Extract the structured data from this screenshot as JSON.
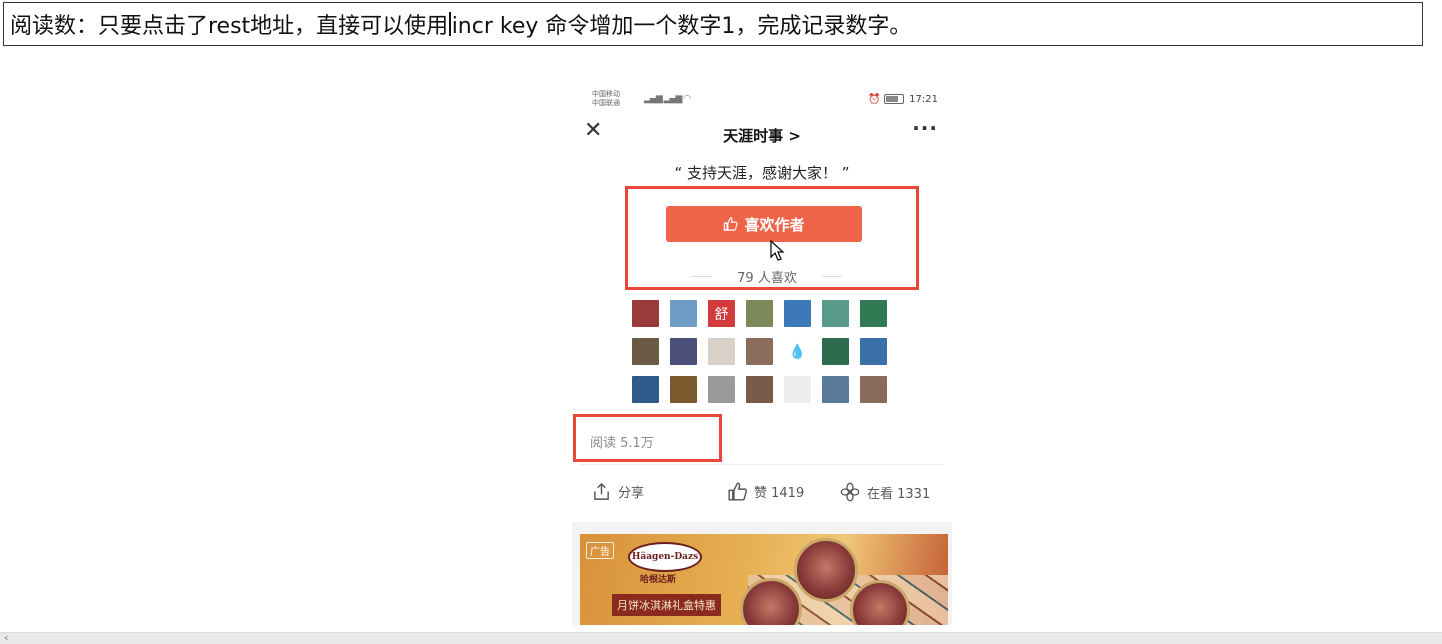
{
  "note": {
    "text_before_caret": "阅读数：只要点击了rest地址，直接可以使用",
    "text_after_caret": "incr key 命令增加一个数字1，完成记录数字。"
  },
  "status_bar": {
    "carrier_1": "中国移动",
    "carrier_2": "中国联通",
    "time": "17:21"
  },
  "nav": {
    "title": "天涯时事 >",
    "close_label": "✕",
    "more_label": "···"
  },
  "quote": "“ 支持天涯，感谢大家！ ”",
  "like": {
    "button_label": "喜欢作者",
    "count_text": "79 人喜欢"
  },
  "avatars": [
    {
      "color": "#9a3b3b",
      "glyph": ""
    },
    {
      "color": "#6e9cc4",
      "glyph": ""
    },
    {
      "color": "#d23b3b",
      "glyph": "舒"
    },
    {
      "color": "#7c8a5a",
      "glyph": ""
    },
    {
      "color": "#3d78b8",
      "glyph": ""
    },
    {
      "color": "#5a9a8a",
      "glyph": ""
    },
    {
      "color": "#2f7a52",
      "glyph": ""
    },
    {
      "color": "#6b5a44",
      "glyph": ""
    },
    {
      "color": "#4a4f7a",
      "glyph": ""
    },
    {
      "color": "#d9d0c8",
      "glyph": ""
    },
    {
      "color": "#8a6d5a",
      "glyph": ""
    },
    {
      "color": "#ffffff",
      "glyph": "💧"
    },
    {
      "color": "#2e6b4e",
      "glyph": ""
    },
    {
      "color": "#3a6fa8",
      "glyph": ""
    },
    {
      "color": "#2f5a8a",
      "glyph": ""
    },
    {
      "color": "#7a5a2a",
      "glyph": ""
    },
    {
      "color": "#9a9a9a",
      "glyph": ""
    },
    {
      "color": "#7a5a4a",
      "glyph": ""
    },
    {
      "color": "#eeeeee",
      "glyph": ""
    },
    {
      "color": "#5a7a9a",
      "glyph": ""
    },
    {
      "color": "#8a6a5a",
      "glyph": ""
    }
  ],
  "read_count": "阅读 5.1万",
  "actions": {
    "share": "分享",
    "like": "赞 1419",
    "watching": "在看 1331"
  },
  "ad": {
    "tag": "广告",
    "brand": "Häagen-Dazs",
    "brand_cn": "哈根达斯",
    "promo": "月饼冰淇淋礼盒特惠"
  },
  "colors": {
    "highlight_red": "#e8473a",
    "like_button": "#ee6449"
  }
}
